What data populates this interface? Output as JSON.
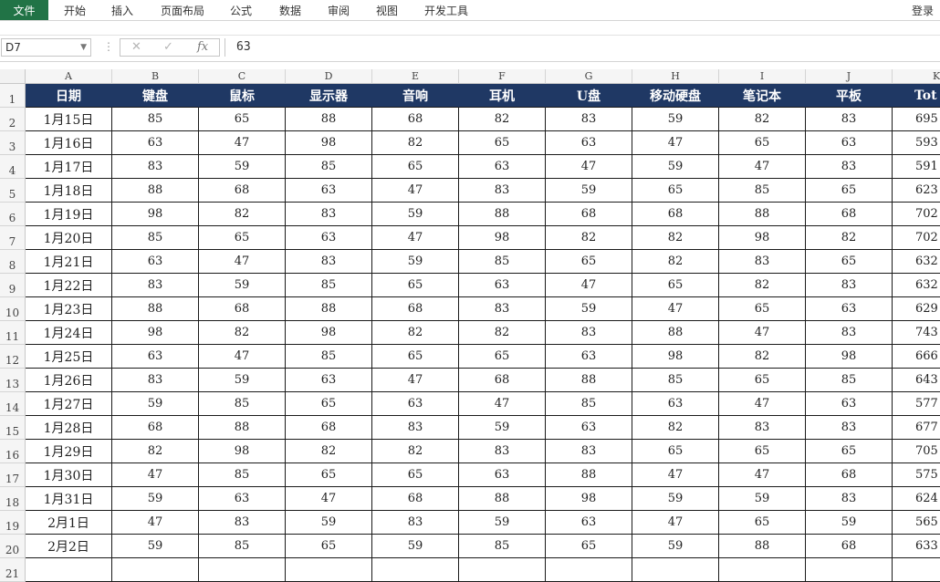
{
  "ribbon": {
    "file_tab": "文件",
    "tabs": [
      "开始",
      "插入",
      "页面布局",
      "公式",
      "数据",
      "审阅",
      "视图",
      "开发工具"
    ],
    "login": "登录"
  },
  "formula_bar": {
    "name_box": "D7",
    "cancel_glyph": "✕",
    "enter_glyph": "✓",
    "function_glyph": "fx",
    "value": "63"
  },
  "sheet": {
    "column_letters": [
      "A",
      "B",
      "C",
      "D",
      "E",
      "F",
      "G",
      "H",
      "I",
      "J",
      "K"
    ],
    "row_numbers": [
      1,
      2,
      3,
      4,
      5,
      6,
      7,
      8,
      9,
      10,
      11,
      12,
      13,
      14,
      15,
      16,
      17,
      18,
      19,
      20,
      21
    ],
    "header_fill": "#1f3864",
    "headers": [
      "日期",
      "键盘",
      "鼠标",
      "显示器",
      "音响",
      "耳机",
      "U盘",
      "移动硬盘",
      "笔记本",
      "平板",
      "Tot"
    ],
    "rows": [
      [
        "1月15日",
        "85",
        "65",
        "88",
        "68",
        "82",
        "83",
        "59",
        "82",
        "83",
        "695"
      ],
      [
        "1月16日",
        "63",
        "47",
        "98",
        "82",
        "65",
        "63",
        "47",
        "65",
        "63",
        "593"
      ],
      [
        "1月17日",
        "83",
        "59",
        "85",
        "65",
        "63",
        "47",
        "59",
        "47",
        "83",
        "591"
      ],
      [
        "1月18日",
        "88",
        "68",
        "63",
        "47",
        "83",
        "59",
        "65",
        "85",
        "65",
        "623"
      ],
      [
        "1月19日",
        "98",
        "82",
        "83",
        "59",
        "88",
        "68",
        "68",
        "88",
        "68",
        "702"
      ],
      [
        "1月20日",
        "85",
        "65",
        "63",
        "47",
        "98",
        "82",
        "82",
        "98",
        "82",
        "702"
      ],
      [
        "1月21日",
        "63",
        "47",
        "83",
        "59",
        "85",
        "65",
        "82",
        "83",
        "65",
        "632"
      ],
      [
        "1月22日",
        "83",
        "59",
        "85",
        "65",
        "63",
        "47",
        "65",
        "82",
        "83",
        "632"
      ],
      [
        "1月23日",
        "88",
        "68",
        "88",
        "68",
        "83",
        "59",
        "47",
        "65",
        "63",
        "629"
      ],
      [
        "1月24日",
        "98",
        "82",
        "98",
        "82",
        "82",
        "83",
        "88",
        "47",
        "83",
        "743"
      ],
      [
        "1月25日",
        "63",
        "47",
        "85",
        "65",
        "65",
        "63",
        "98",
        "82",
        "98",
        "666"
      ],
      [
        "1月26日",
        "83",
        "59",
        "63",
        "47",
        "68",
        "88",
        "85",
        "65",
        "85",
        "643"
      ],
      [
        "1月27日",
        "59",
        "85",
        "65",
        "63",
        "47",
        "85",
        "63",
        "47",
        "63",
        "577"
      ],
      [
        "1月28日",
        "68",
        "88",
        "68",
        "83",
        "59",
        "63",
        "82",
        "83",
        "83",
        "677"
      ],
      [
        "1月29日",
        "82",
        "98",
        "82",
        "82",
        "83",
        "83",
        "65",
        "65",
        "65",
        "705"
      ],
      [
        "1月30日",
        "47",
        "85",
        "65",
        "65",
        "63",
        "88",
        "47",
        "47",
        "68",
        "575"
      ],
      [
        "1月31日",
        "59",
        "63",
        "47",
        "68",
        "88",
        "98",
        "59",
        "59",
        "83",
        "624"
      ],
      [
        "2月1日",
        "47",
        "83",
        "59",
        "83",
        "59",
        "63",
        "47",
        "65",
        "59",
        "565"
      ],
      [
        "2月2日",
        "59",
        "85",
        "65",
        "59",
        "85",
        "65",
        "59",
        "88",
        "68",
        "633"
      ]
    ]
  }
}
